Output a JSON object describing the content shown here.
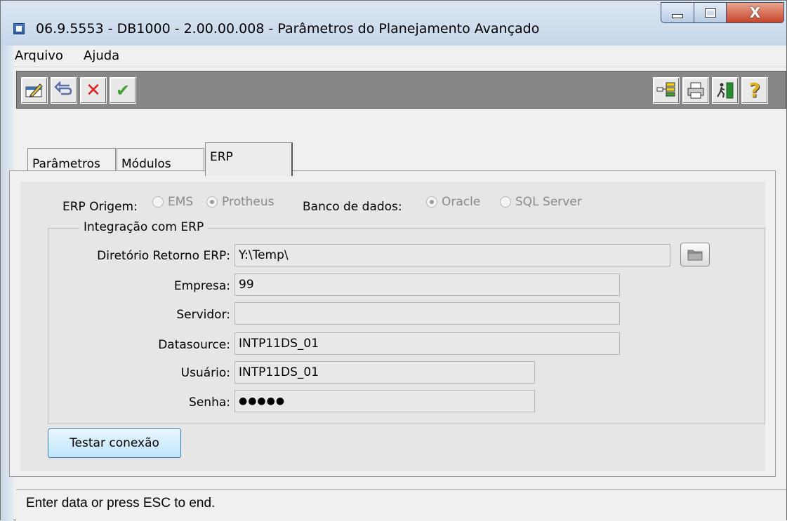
{
  "window": {
    "title": "06.9.5553 - DB1000 - 2.00.00.008 - Parâmetros do Planejamento Avançado",
    "controls": {
      "minimize": "minimize-icon",
      "maximize": "maximize-icon",
      "close": "close-icon",
      "close_glyph": "X"
    }
  },
  "menu": {
    "items": [
      "Arquivo",
      "Ajuda"
    ]
  },
  "toolbar": {
    "left_buttons": [
      "edit-icon",
      "undo-icon",
      "cancel-icon",
      "confirm-icon"
    ],
    "right_buttons": [
      "tree-icon",
      "print-icon",
      "exit-icon",
      "help-icon"
    ],
    "glyphs": {
      "cancel": "✕",
      "confirm": "✔",
      "help": "?"
    }
  },
  "tabs": [
    "Parâmetros",
    "Módulos",
    "ERP"
  ],
  "active_tab": "ERP",
  "erp": {
    "origin_label": "ERP Origem:",
    "origin_options": [
      "EMS",
      "Protheus"
    ],
    "origin_selected": "Protheus",
    "db_label": "Banco de dados:",
    "db_options": [
      "Oracle",
      "SQL Server"
    ],
    "db_selected": "Oracle"
  },
  "integration": {
    "group_title": "Integração com ERP",
    "fields": {
      "directory": {
        "label": "Diretório Retorno ERP:",
        "value": "Y:\\Temp\\"
      },
      "company": {
        "label": "Empresa:",
        "value": "99"
      },
      "server": {
        "label": "Servidor:",
        "value": ""
      },
      "datasource": {
        "label": "Datasource:",
        "value": "INTP11DS_01"
      },
      "user": {
        "label": "Usuário:",
        "value": "INTP11DS_01"
      },
      "password": {
        "label": "Senha:",
        "value": "●●●●●"
      }
    }
  },
  "actions": {
    "test_connection": "Testar conexão"
  },
  "status": {
    "text": "Enter data or press ESC to end."
  }
}
